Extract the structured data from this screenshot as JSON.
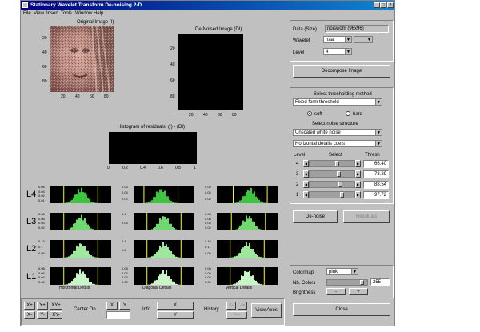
{
  "window": {
    "title": "Stationary Wavelet Transform De-noising 2-D",
    "controls": {
      "minimize": "_",
      "maximize": "□",
      "close": "×"
    }
  },
  "menu": [
    "File",
    "View",
    "Insert",
    "Tools",
    "Window",
    "Help"
  ],
  "images": {
    "original_title": "Original Image (I)",
    "denoised_title": "De-Noised Image (DI)",
    "original_yticks": [
      "20",
      "40",
      "60",
      "80"
    ],
    "original_xticks": [
      "20",
      "40",
      "60",
      "80"
    ],
    "denoised_yticks": [
      "20",
      "40",
      "60",
      "80"
    ],
    "denoised_xticks": [
      "20",
      "40",
      "60",
      "80"
    ]
  },
  "residuals": {
    "title": "Histogram of residuals: (I) - (DI)",
    "xticks": [
      "0",
      "0.2",
      "0.4",
      "0.6",
      "0.8",
      "1"
    ]
  },
  "detail_labels": {
    "levels": [
      "L4",
      "L3",
      "L2",
      "L1"
    ],
    "columns": [
      "Horizontal Details",
      "Diagonal Details",
      "Vertical Details"
    ]
  },
  "histograms": [
    [
      {
        "yticks": [
          "0.05",
          "0.04",
          "0.02",
          "0.01"
        ],
        "color": "#3ec43e",
        "peak": 0.5
      },
      {
        "yticks": [
          "0.06",
          "0.04",
          "0.02"
        ],
        "color": "#3ec43e",
        "peak": 0.45
      },
      {
        "yticks": [
          "0.05",
          "0.04",
          "0.02"
        ],
        "color": "#3ec43e",
        "peak": 0.55
      }
    ],
    [
      {
        "yticks": [
          "0.08",
          "0.06",
          "0.04",
          "0.02"
        ],
        "color": "#6fd86f",
        "peak": 0.5
      },
      {
        "yticks": [
          "0.1",
          "0.05"
        ],
        "color": "#6fd86f",
        "peak": 0.5
      },
      {
        "yticks": [
          "0.08",
          "0.06",
          "0.04",
          "0.02"
        ],
        "color": "#6fd86f",
        "peak": 0.52
      }
    ],
    [
      {
        "yticks": [
          "0.15",
          "0.1",
          "0.05"
        ],
        "color": "#9ee89e",
        "peak": 0.5
      },
      {
        "yticks": [
          "0.4",
          "0.2"
        ],
        "color": "#9ee89e",
        "peak": 0.5
      },
      {
        "yticks": [
          "0.15",
          "0.1",
          "0.05"
        ],
        "color": "#9ee89e",
        "peak": 0.5
      }
    ],
    [
      {
        "yticks": [
          "0.08",
          "0.06",
          "0.04",
          "0.02"
        ],
        "color": "#c8f5c8",
        "peak": 0.5
      },
      {
        "yticks": [
          "0.08",
          "0.06",
          "0.04",
          "0.02"
        ],
        "color": "#c8f5c8",
        "peak": 0.5
      },
      {
        "yticks": [
          "0.08",
          "0.06",
          "0.04",
          "0.02"
        ],
        "color": "#c8f5c8",
        "peak": 0.5
      }
    ]
  ],
  "data_panel": {
    "data_label": "Data  (Size)",
    "data_value": "noiswom  (96x96)",
    "wavelet_label": "Wavelet",
    "wavelet_value": "haar",
    "wavelet_num": "",
    "level_label": "Level",
    "level_value": "4",
    "decompose_label": "Decompose Image"
  },
  "threshold": {
    "title": "Select thresholding method",
    "method": "Fixed form threshold",
    "soft_label": "soft",
    "hard_label": "hard",
    "soft_selected": true,
    "noise_title": "Select noise structure",
    "noise_value": "Unscaled white noise",
    "details_value": "Horizontal details coefs",
    "col_level": "Level",
    "col_select": "Select",
    "col_thresh": "Thresh",
    "rows": [
      {
        "level": "4",
        "value": "66.40",
        "slider": 0.62
      },
      {
        "level": "3",
        "value": "78.29",
        "slider": 0.66
      },
      {
        "level": "2",
        "value": "88.54",
        "slider": 0.7
      },
      {
        "level": "1",
        "value": "97.72",
        "slider": 0.74
      }
    ]
  },
  "actions": {
    "denoise_label": "De-noise",
    "residuals_label": "Residuals"
  },
  "colormap": {
    "colormap_label": "Colormap",
    "colormap_value": "pink",
    "nbcolors_label": "Nb. Colors",
    "nbcolors_value": "255",
    "nbcolors_slider": 0.92,
    "brightness_label": "Brightness",
    "minus_label": "-",
    "plus_label": "+"
  },
  "close_label": "Close",
  "bottom": {
    "xplus": "X+",
    "yplus": "Y+",
    "xyplus": "XY+",
    "xminus": "X-",
    "yminus": "Y-",
    "xyminus": "XY-",
    "center_on": "Center On",
    "x_label": "X",
    "y_label": "Y",
    "center_value": "",
    "info_label": "Info",
    "info_x": "X",
    "info_y": "Y",
    "history_label": "History",
    "history_back": "<-",
    "history_fwd": "->",
    "history_home": "<<-",
    "view_axes": "View Axes"
  }
}
